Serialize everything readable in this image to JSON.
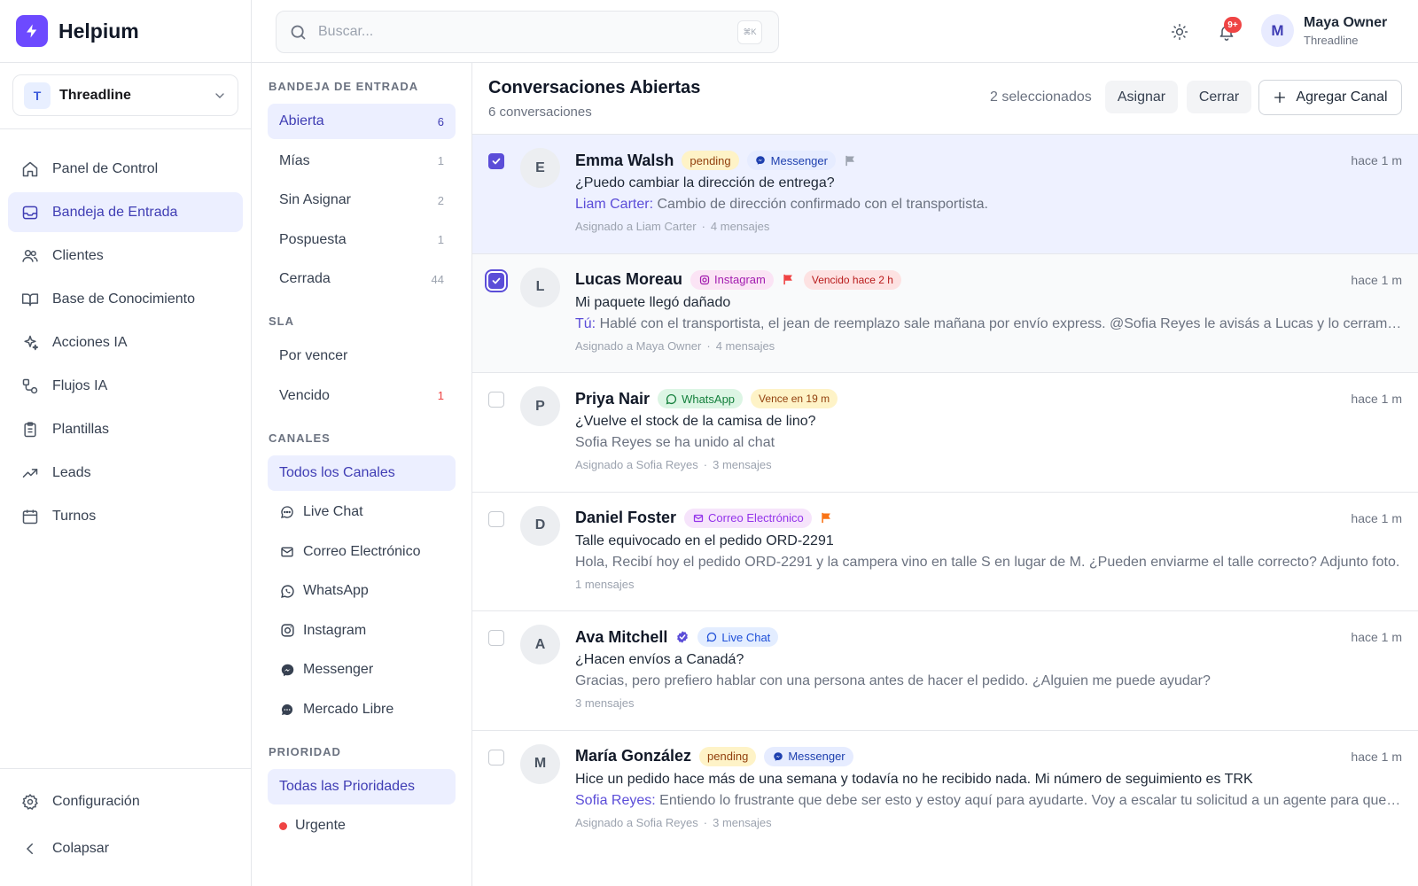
{
  "app": {
    "name": "Helpium"
  },
  "workspace": {
    "initial": "T",
    "name": "Threadline"
  },
  "nav": {
    "items": [
      {
        "label": "Panel de Control",
        "icon": "home-icon",
        "active": false
      },
      {
        "label": "Bandeja de Entrada",
        "icon": "inbox-icon",
        "active": true
      },
      {
        "label": "Clientes",
        "icon": "users-icon",
        "active": false
      },
      {
        "label": "Base de Conocimiento",
        "icon": "book-icon",
        "active": false
      },
      {
        "label": "Acciones IA",
        "icon": "sparkle-icon",
        "active": false
      },
      {
        "label": "Flujos IA",
        "icon": "flow-icon",
        "active": false
      },
      {
        "label": "Plantillas",
        "icon": "clipboard-icon",
        "active": false
      },
      {
        "label": "Leads",
        "icon": "trending-up-icon",
        "active": false
      },
      {
        "label": "Turnos",
        "icon": "calendar-icon",
        "active": false
      }
    ],
    "settings_label": "Configuración",
    "collapse_label": "Colapsar"
  },
  "topbar": {
    "search_placeholder": "Buscar...",
    "shortcut": "⌘K",
    "notif_count": "9+",
    "user": {
      "initial": "M",
      "name": "Maya Owner",
      "org": "Threadline"
    }
  },
  "filters": {
    "inbox_title": "BANDEJA DE ENTRADA",
    "inbox": [
      {
        "label": "Abierta",
        "count": "6",
        "active": true
      },
      {
        "label": "Mías",
        "count": "1",
        "active": false
      },
      {
        "label": "Sin Asignar",
        "count": "2",
        "active": false
      },
      {
        "label": "Pospuesta",
        "count": "1",
        "active": false
      },
      {
        "label": "Cerrada",
        "count": "44",
        "active": false
      }
    ],
    "sla_title": "SLA",
    "sla": [
      {
        "label": "Por vencer",
        "count": ""
      },
      {
        "label": "Vencido",
        "count": "1"
      }
    ],
    "channels_title": "CANALES",
    "channels": [
      {
        "label": "Todos los Canales",
        "icon": "",
        "active": true
      },
      {
        "label": "Live Chat",
        "icon": "chat-bubble-icon",
        "active": false
      },
      {
        "label": "Correo Electrónico",
        "icon": "mail-icon",
        "active": false
      },
      {
        "label": "WhatsApp",
        "icon": "whatsapp-icon",
        "active": false
      },
      {
        "label": "Instagram",
        "icon": "instagram-icon",
        "active": false
      },
      {
        "label": "Messenger",
        "icon": "messenger-icon",
        "active": false
      },
      {
        "label": "Mercado Libre",
        "icon": "mercadolibre-icon",
        "active": false
      }
    ],
    "priority_title": "PRIORIDAD",
    "priorities": [
      {
        "label": "Todas las Prioridades",
        "active": true
      },
      {
        "label": "Urgente",
        "color": "#ef4444",
        "active": false
      }
    ]
  },
  "main": {
    "title": "Conversaciones Abiertas",
    "subtitle": "6 conversaciones",
    "selected_text": "2 seleccionados",
    "assign_label": "Asignar",
    "close_label": "Cerrar",
    "add_channel_label": "Agregar Canal"
  },
  "conversations": [
    {
      "initial": "E",
      "name": "Emma Walsh",
      "status": "pending",
      "channel": "Messenger",
      "flag_color": "#9ca3af",
      "sla": "",
      "time": "hace 1 m",
      "subject": "¿Puedo cambiar la dirección de entrega?",
      "preview_author": "Liam Carter:",
      "preview": "Cambio de dirección confirmado con el transportista.",
      "assigned": "Asignado a Liam Carter",
      "messages": "4 mensajes",
      "checked": true
    },
    {
      "initial": "L",
      "name": "Lucas Moreau",
      "status": "",
      "channel": "Instagram",
      "flag_color": "#ef4444",
      "sla": "Vencido hace 2 h",
      "time": "hace 1 m",
      "subject": "Mi paquete llegó dañado",
      "preview_author": "Tú:",
      "preview": "Hablé con el transportista, el jean de reemplazo sale mañana por envío express. @Sofia Reyes le avisás a Lucas y lo cerramos?",
      "assigned": "Asignado a Maya Owner",
      "messages": "4 mensajes",
      "checked": true
    },
    {
      "initial": "P",
      "name": "Priya Nair",
      "status": "",
      "channel": "WhatsApp",
      "flag_color": "",
      "sla": "Vence en 19 m",
      "time": "hace 1 m",
      "subject": "¿Vuelve el stock de la camisa de lino?",
      "preview_author": "",
      "preview": "Sofia Reyes se ha unido al chat",
      "assigned": "Asignado a Sofia Reyes",
      "messages": "3 mensajes",
      "checked": false
    },
    {
      "initial": "D",
      "name": "Daniel Foster",
      "status": "",
      "channel": "Correo Electrónico",
      "flag_color": "#f97316",
      "sla": "",
      "time": "hace 1 m",
      "subject": "Talle equivocado en el pedido ORD-2291",
      "preview_author": "",
      "preview": "Hola, Recibí hoy el pedido ORD-2291 y la campera vino en talle S en lugar de M. ¿Pueden enviarme el talle correcto? Adjunto foto.",
      "assigned": "",
      "messages": "1 mensajes",
      "checked": false
    },
    {
      "initial": "A",
      "name": "Ava Mitchell",
      "status": "",
      "channel": "Live Chat",
      "flag_color": "",
      "sla": "",
      "verified": true,
      "time": "hace 1 m",
      "subject": "¿Hacen envíos a Canadá?",
      "preview_author": "",
      "preview": "Gracias, pero prefiero hablar con una persona antes de hacer el pedido. ¿Alguien me puede ayudar?",
      "assigned": "",
      "messages": "3 mensajes",
      "checked": false
    },
    {
      "initial": "M",
      "name": "María González",
      "status": "pending",
      "channel": "Messenger",
      "flag_color": "",
      "sla": "",
      "time": "hace 1 m",
      "subject": "Hice un pedido hace más de una semana y todavía no he recibido nada. Mi número de seguimiento es TRK",
      "preview_author": "Sofia Reyes:",
      "preview": "Entiendo lo frustrante que debe ser esto y estoy aquí para ayudarte. Voy a escalar tu solicitud a un agente para que lo revise.",
      "assigned": "Asignado a Sofia Reyes",
      "messages": "3 mensajes",
      "checked": false
    }
  ]
}
